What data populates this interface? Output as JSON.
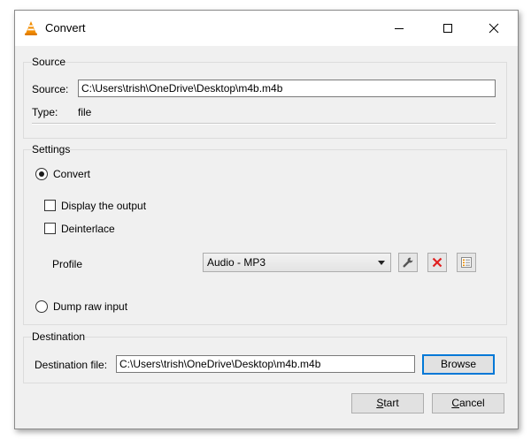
{
  "window": {
    "title": "Convert"
  },
  "source": {
    "group_title": "Source",
    "source_label": "Source:",
    "source_value": "C:\\Users\\trish\\OneDrive\\Desktop\\m4b.m4b",
    "type_label": "Type:",
    "type_value": "file"
  },
  "settings": {
    "group_title": "Settings",
    "convert_label": "Convert",
    "display_output_label": "Display the output",
    "deinterlace_label": "Deinterlace",
    "profile_label": "Profile",
    "profile_selected": "Audio - MP3",
    "dump_raw_label": "Dump raw input",
    "convert_selected": true,
    "display_output_checked": false,
    "deinterlace_checked": false
  },
  "destination": {
    "group_title": "Destination",
    "file_label": "Destination file:",
    "file_value": "C:\\Users\\trish\\OneDrive\\Desktop\\m4b.m4b",
    "browse_label": "Browse"
  },
  "actions": {
    "start_first": "S",
    "start_rest": "tart",
    "cancel_first": "C",
    "cancel_rest": "ancel"
  },
  "colors": {
    "accent": "#0078d7",
    "delete_red": "#e02020",
    "vlc_orange": "#f28c00"
  },
  "icons": {
    "app": "vlc-cone-icon",
    "edit_profile": "wrench-icon",
    "delete_profile": "red-x-icon",
    "new_profile": "profile-list-icon"
  }
}
